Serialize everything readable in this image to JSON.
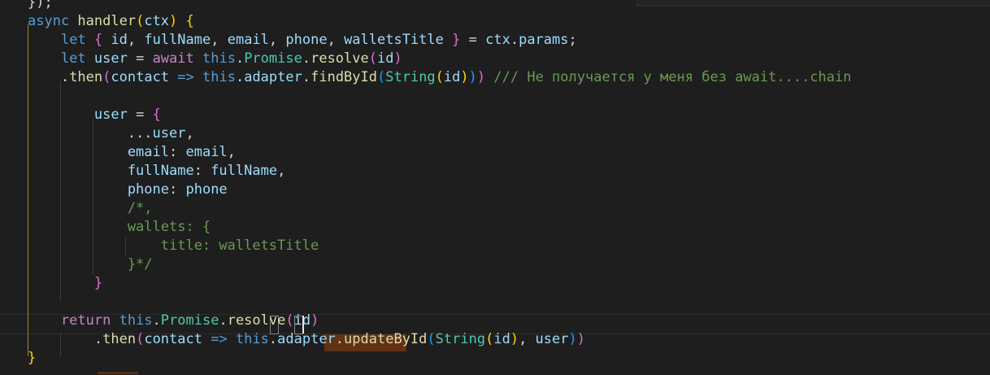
{
  "editor": {
    "colors": {
      "background": "#1e1e1e",
      "keyword": "#569cd6",
      "function": "#dcdcaa",
      "variable": "#9cdcfe",
      "class": "#4ec9b0",
      "comment": "#6a9955",
      "punctuation": "#d4d4d4",
      "bracket_gold": "#ffd700",
      "bracket_purple": "#da70d6",
      "bracket_blue": "#179fff"
    },
    "lines": [
      {
        "name": "code-line-1",
        "tokens": [
          {
            "t": "});",
            "c": "#d4d4d4"
          }
        ]
      },
      {
        "name": "code-line-2",
        "tokens": [
          {
            "t": "async ",
            "c": "#569cd6"
          },
          {
            "t": "handler",
            "c": "#dcdcaa"
          },
          {
            "t": "(",
            "c": "#ffd700"
          },
          {
            "t": "ctx",
            "c": "#9cdcfe"
          },
          {
            "t": ")",
            "c": "#ffd700"
          },
          {
            "t": " ",
            "c": "#d4d4d4"
          },
          {
            "t": "{",
            "c": "#ffd700"
          }
        ]
      },
      {
        "name": "code-line-3",
        "tokens": [
          {
            "t": "    let ",
            "c": "#569cd6"
          },
          {
            "t": "{",
            "c": "#da70d6"
          },
          {
            "t": " id",
            "c": "#9cdcfe"
          },
          {
            "t": ", ",
            "c": "#d4d4d4"
          },
          {
            "t": "fullName",
            "c": "#9cdcfe"
          },
          {
            "t": ", ",
            "c": "#d4d4d4"
          },
          {
            "t": "email",
            "c": "#9cdcfe"
          },
          {
            "t": ", ",
            "c": "#d4d4d4"
          },
          {
            "t": "phone",
            "c": "#9cdcfe"
          },
          {
            "t": ", ",
            "c": "#d4d4d4"
          },
          {
            "t": "walletsTitle",
            "c": "#9cdcfe"
          },
          {
            "t": " ",
            "c": "#d4d4d4"
          },
          {
            "t": "}",
            "c": "#da70d6"
          },
          {
            "t": " = ",
            "c": "#d4d4d4"
          },
          {
            "t": "ctx",
            "c": "#9cdcfe"
          },
          {
            "t": ".",
            "c": "#d4d4d4"
          },
          {
            "t": "params",
            "c": "#9cdcfe"
          },
          {
            "t": ";",
            "c": "#d4d4d4"
          }
        ]
      },
      {
        "name": "code-line-4",
        "tokens": [
          {
            "t": "    let ",
            "c": "#569cd6"
          },
          {
            "t": "user",
            "c": "#9cdcfe"
          },
          {
            "t": " = ",
            "c": "#d4d4d4"
          },
          {
            "t": "await ",
            "c": "#c586c0"
          },
          {
            "t": "this",
            "c": "#569cd6"
          },
          {
            "t": ".",
            "c": "#d4d4d4"
          },
          {
            "t": "Promise",
            "c": "#4ec9b0"
          },
          {
            "t": ".",
            "c": "#d4d4d4"
          },
          {
            "t": "resolve",
            "c": "#dcdcaa"
          },
          {
            "t": "(",
            "c": "#da70d6"
          },
          {
            "t": "id",
            "c": "#9cdcfe"
          },
          {
            "t": ")",
            "c": "#da70d6"
          }
        ]
      },
      {
        "name": "code-line-5",
        "tokens": [
          {
            "t": "    .",
            "c": "#d4d4d4"
          },
          {
            "t": "then",
            "c": "#dcdcaa"
          },
          {
            "t": "(",
            "c": "#da70d6"
          },
          {
            "t": "contact",
            "c": "#9cdcfe"
          },
          {
            "t": " => ",
            "c": "#569cd6"
          },
          {
            "t": "this",
            "c": "#569cd6"
          },
          {
            "t": ".",
            "c": "#d4d4d4"
          },
          {
            "t": "adapter",
            "c": "#9cdcfe"
          },
          {
            "t": ".",
            "c": "#d4d4d4"
          },
          {
            "t": "findById",
            "c": "#dcdcaa"
          },
          {
            "t": "(",
            "c": "#179fff"
          },
          {
            "t": "String",
            "c": "#4ec9b0"
          },
          {
            "t": "(",
            "c": "#ffd700"
          },
          {
            "t": "id",
            "c": "#9cdcfe"
          },
          {
            "t": ")",
            "c": "#ffd700"
          },
          {
            "t": ")",
            "c": "#179fff"
          },
          {
            "t": ")",
            "c": "#da70d6"
          },
          {
            "t": " /// Не получается у меня без await....chain",
            "c": "#6a9955"
          }
        ]
      },
      {
        "name": "code-line-6",
        "tokens": []
      },
      {
        "name": "code-line-7",
        "tokens": [
          {
            "t": "        ",
            "c": "#d4d4d4"
          },
          {
            "t": "user",
            "c": "#9cdcfe"
          },
          {
            "t": " = ",
            "c": "#d4d4d4"
          },
          {
            "t": "{",
            "c": "#da70d6"
          }
        ]
      },
      {
        "name": "code-line-8",
        "tokens": [
          {
            "t": "            ...",
            "c": "#d4d4d4"
          },
          {
            "t": "user",
            "c": "#9cdcfe"
          },
          {
            "t": ",",
            "c": "#d4d4d4"
          }
        ]
      },
      {
        "name": "code-line-9",
        "tokens": [
          {
            "t": "            email",
            "c": "#9cdcfe"
          },
          {
            "t": ": ",
            "c": "#d4d4d4"
          },
          {
            "t": "email",
            "c": "#9cdcfe"
          },
          {
            "t": ",",
            "c": "#d4d4d4"
          }
        ]
      },
      {
        "name": "code-line-10",
        "tokens": [
          {
            "t": "            fullName",
            "c": "#9cdcfe"
          },
          {
            "t": ": ",
            "c": "#d4d4d4"
          },
          {
            "t": "fullName",
            "c": "#9cdcfe"
          },
          {
            "t": ",",
            "c": "#d4d4d4"
          }
        ]
      },
      {
        "name": "code-line-11",
        "tokens": [
          {
            "t": "            phone",
            "c": "#9cdcfe"
          },
          {
            "t": ": ",
            "c": "#d4d4d4"
          },
          {
            "t": "phone",
            "c": "#9cdcfe"
          }
        ]
      },
      {
        "name": "code-line-12",
        "tokens": [
          {
            "t": "            /*,",
            "c": "#6a9955"
          }
        ]
      },
      {
        "name": "code-line-13",
        "tokens": [
          {
            "t": "            wallets: {",
            "c": "#6a9955"
          }
        ]
      },
      {
        "name": "code-line-14",
        "tokens": [
          {
            "t": "                title: walletsTitle",
            "c": "#6a9955"
          }
        ]
      },
      {
        "name": "code-line-15",
        "tokens": [
          {
            "t": "            }*/",
            "c": "#6a9955"
          }
        ]
      },
      {
        "name": "code-line-16",
        "tokens": [
          {
            "t": "        ",
            "c": "#d4d4d4"
          },
          {
            "t": "}",
            "c": "#da70d6"
          }
        ]
      },
      {
        "name": "code-line-17",
        "tokens": []
      },
      {
        "name": "code-line-18",
        "tokens": [
          {
            "t": "    return ",
            "c": "#c586c0"
          },
          {
            "t": "this",
            "c": "#569cd6"
          },
          {
            "t": ".",
            "c": "#d4d4d4"
          },
          {
            "t": "Promise",
            "c": "#4ec9b0"
          },
          {
            "t": ".",
            "c": "#d4d4d4"
          },
          {
            "t": "resolve",
            "c": "#dcdcaa"
          },
          {
            "t": "(",
            "c": "#da70d6"
          },
          {
            "t": "id",
            "c": "#9cdcfe"
          },
          {
            "t": ")",
            "c": "#da70d6"
          }
        ]
      },
      {
        "name": "code-line-19",
        "tokens": [
          {
            "t": "        .",
            "c": "#d4d4d4"
          },
          {
            "t": "then",
            "c": "#dcdcaa"
          },
          {
            "t": "(",
            "c": "#da70d6"
          },
          {
            "t": "contact",
            "c": "#9cdcfe"
          },
          {
            "t": " => ",
            "c": "#569cd6"
          },
          {
            "t": "this",
            "c": "#569cd6"
          },
          {
            "t": ".",
            "c": "#d4d4d4"
          },
          {
            "t": "adapter",
            "c": "#9cdcfe"
          },
          {
            "t": ".",
            "c": "#d4d4d4"
          },
          {
            "t": "updateById",
            "c": "#dcdcaa"
          },
          {
            "t": "(",
            "c": "#179fff"
          },
          {
            "t": "String",
            "c": "#4ec9b0"
          },
          {
            "t": "(",
            "c": "#ffd700"
          },
          {
            "t": "id",
            "c": "#9cdcfe"
          },
          {
            "t": ")",
            "c": "#ffd700"
          },
          {
            "t": ", ",
            "c": "#d4d4d4"
          },
          {
            "t": "user",
            "c": "#9cdcfe"
          },
          {
            "t": ")",
            "c": "#179fff"
          },
          {
            "t": ")",
            "c": "#da70d6"
          }
        ]
      },
      {
        "name": "code-line-20",
        "tokens": [
          {
            "t": "}",
            "c": "#ffd700"
          }
        ]
      }
    ]
  }
}
